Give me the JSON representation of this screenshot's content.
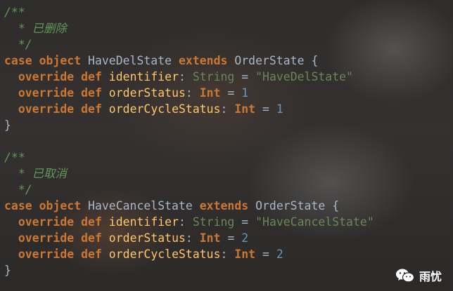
{
  "code": {
    "lines": [
      [
        {
          "t": "/**",
          "c": "comment"
        }
      ],
      [
        {
          "t": "  * 已删除",
          "c": "comment"
        }
      ],
      [
        {
          "t": "  */",
          "c": "comment"
        }
      ],
      [
        {
          "t": "case",
          "c": "kw"
        },
        {
          "t": " ",
          "c": "punc"
        },
        {
          "t": "object",
          "c": "kw"
        },
        {
          "t": " HaveDelState ",
          "c": "cls"
        },
        {
          "t": "extends",
          "c": "kw"
        },
        {
          "t": " OrderState {",
          "c": "cls"
        }
      ],
      [
        {
          "t": "  ",
          "c": "punc"
        },
        {
          "t": "override",
          "c": "kw"
        },
        {
          "t": " ",
          "c": "punc"
        },
        {
          "t": "def",
          "c": "kw"
        },
        {
          "t": " identifier",
          "c": "field"
        },
        {
          "t": ": ",
          "c": "punc"
        },
        {
          "t": "String",
          "c": "str"
        },
        {
          "t": " = ",
          "c": "punc"
        },
        {
          "t": "\"HaveDelState\"",
          "c": "str"
        }
      ],
      [
        {
          "t": "  ",
          "c": "punc"
        },
        {
          "t": "override",
          "c": "kw"
        },
        {
          "t": " ",
          "c": "punc"
        },
        {
          "t": "def",
          "c": "kw"
        },
        {
          "t": " orderStatus",
          "c": "field"
        },
        {
          "t": ": ",
          "c": "punc"
        },
        {
          "t": "Int",
          "c": "kw"
        },
        {
          "t": " = ",
          "c": "punc"
        },
        {
          "t": "1",
          "c": "num"
        }
      ],
      [
        {
          "t": "  ",
          "c": "punc"
        },
        {
          "t": "override",
          "c": "kw"
        },
        {
          "t": " ",
          "c": "punc"
        },
        {
          "t": "def",
          "c": "kw"
        },
        {
          "t": " orderCycleStatus",
          "c": "field"
        },
        {
          "t": ": ",
          "c": "punc"
        },
        {
          "t": "Int",
          "c": "kw"
        },
        {
          "t": " = ",
          "c": "punc"
        },
        {
          "t": "1",
          "c": "num"
        }
      ],
      [
        {
          "t": "}",
          "c": "punc"
        }
      ],
      [
        {
          "t": "",
          "c": "punc"
        }
      ],
      [
        {
          "t": "/**",
          "c": "comment"
        }
      ],
      [
        {
          "t": "  * 已取消",
          "c": "comment"
        }
      ],
      [
        {
          "t": "  */",
          "c": "comment"
        }
      ],
      [
        {
          "t": "case",
          "c": "kw"
        },
        {
          "t": " ",
          "c": "punc"
        },
        {
          "t": "object",
          "c": "kw"
        },
        {
          "t": " HaveCancelState ",
          "c": "cls"
        },
        {
          "t": "extends",
          "c": "kw"
        },
        {
          "t": " OrderState {",
          "c": "cls"
        }
      ],
      [
        {
          "t": "  ",
          "c": "punc"
        },
        {
          "t": "override",
          "c": "kw"
        },
        {
          "t": " ",
          "c": "punc"
        },
        {
          "t": "def",
          "c": "kw"
        },
        {
          "t": " identifier",
          "c": "field"
        },
        {
          "t": ": ",
          "c": "punc"
        },
        {
          "t": "String",
          "c": "str"
        },
        {
          "t": " = ",
          "c": "punc"
        },
        {
          "t": "\"HaveCancelState\"",
          "c": "str"
        }
      ],
      [
        {
          "t": "  ",
          "c": "punc"
        },
        {
          "t": "override",
          "c": "kw"
        },
        {
          "t": " ",
          "c": "punc"
        },
        {
          "t": "def",
          "c": "kw"
        },
        {
          "t": " orderStatus",
          "c": "field"
        },
        {
          "t": ": ",
          "c": "punc"
        },
        {
          "t": "Int",
          "c": "kw"
        },
        {
          "t": " = ",
          "c": "punc"
        },
        {
          "t": "2",
          "c": "num"
        }
      ],
      [
        {
          "t": "  ",
          "c": "punc"
        },
        {
          "t": "override",
          "c": "kw"
        },
        {
          "t": " ",
          "c": "punc"
        },
        {
          "t": "def",
          "c": "kw"
        },
        {
          "t": " orderCycleStatus",
          "c": "field"
        },
        {
          "t": ": ",
          "c": "punc"
        },
        {
          "t": "Int",
          "c": "kw"
        },
        {
          "t": " = ",
          "c": "punc"
        },
        {
          "t": "2",
          "c": "num"
        }
      ],
      [
        {
          "t": "}",
          "c": "punc"
        }
      ]
    ]
  },
  "watermark": {
    "icon": "wechat-icon",
    "label": "雨忧"
  },
  "colors": {
    "background": "#2b2b2b",
    "comment": "#629755",
    "keyword": "#cc7832",
    "string": "#6a8759",
    "number": "#6897bb",
    "identifier": "#ffc66d",
    "default": "#a9b7c6"
  }
}
